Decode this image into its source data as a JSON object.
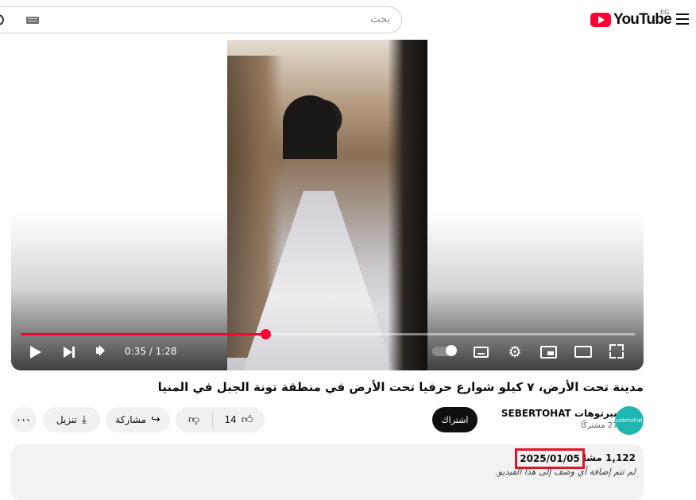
{
  "header": {
    "search_placeholder": "بحث",
    "logo_text": "YouTube",
    "country_code": "EG"
  },
  "player": {
    "current_time": "0:35",
    "duration": "1:28",
    "time_display": "0:35 / 1:28",
    "progress_fraction": 0.398,
    "progress_color": "#ff0033"
  },
  "video": {
    "title": "مدينة تحت الأرض، ٧ كيلو شوارع حرفيا تحت الأرض في منطقة تونة الجبل في المنيا"
  },
  "channel": {
    "name": "سبرتوهات SEBERTOHAT",
    "subscribers": "277 مشتركًا",
    "avatar_text": "sebrtohat",
    "avatar_color": "#1fb5b0",
    "subscribe_label": "اشتراك"
  },
  "actions": {
    "likes": "14",
    "share_label": "مشاركة",
    "download_label": "تنزيل",
    "more_label": "···"
  },
  "description": {
    "views": "1,122 مشاهدة",
    "upload_date": "2025/01/05",
    "text": "لم تتم إضافة أي وصف إلى هذا الفيديو."
  }
}
